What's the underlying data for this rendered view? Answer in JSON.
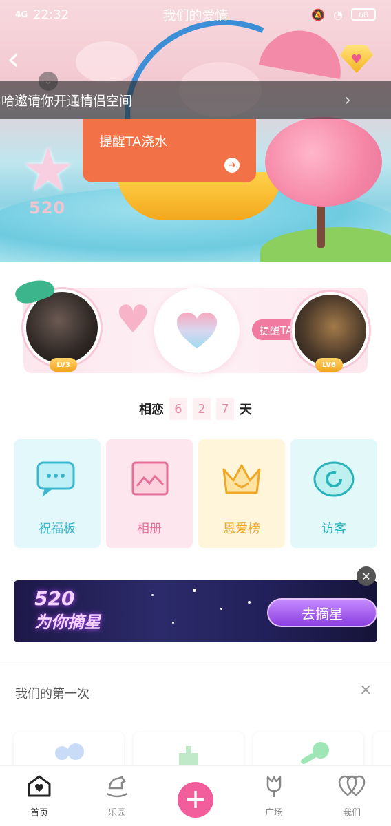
{
  "status_bar": {
    "signal": "4G",
    "time": "22:32",
    "title": "我们的爱情",
    "battery": "68"
  },
  "nav": {
    "back_icon": "chevron-left-icon",
    "gem_icon": "diamond-heart-icon",
    "collapse_icon": "chevron-down-icon"
  },
  "invite_banner": {
    "text": "哈邀请你开通情侣空间",
    "arrow": "›"
  },
  "remind_water": {
    "label": "提醒TA浇水",
    "go": "➔"
  },
  "hero": {
    "star_value": "520"
  },
  "couple": {
    "left_level": "LV3",
    "right_level": "LV6",
    "remind_label": "提醒TA"
  },
  "days": {
    "prefix": "相恋",
    "digits": [
      "6",
      "2",
      "7"
    ],
    "suffix": "天"
  },
  "tiles": [
    {
      "label": "祝福板",
      "icon": "message-bubble-icon",
      "color": "#3bb7cf"
    },
    {
      "label": "相册",
      "icon": "photo-album-icon",
      "color": "#e56f98"
    },
    {
      "label": "恩爱榜",
      "icon": "crown-icon",
      "color": "#f0a726"
    },
    {
      "label": "访客",
      "icon": "visitor-ring-icon",
      "color": "#27b3b9"
    }
  ],
  "promo": {
    "title_line1": "520",
    "title_line2": "为你摘星",
    "button": "去摘星"
  },
  "first_time": {
    "title": "我们的第一次",
    "close": "×"
  },
  "bottom_nav": [
    {
      "label": "首页",
      "icon": "home-heart-icon",
      "active": true
    },
    {
      "label": "乐园",
      "icon": "rocking-horse-icon",
      "active": false
    },
    {
      "label": "+",
      "icon": "add-icon",
      "active": false
    },
    {
      "label": "广场",
      "icon": "tulip-icon",
      "active": false
    },
    {
      "label": "我们",
      "icon": "double-heart-icon",
      "active": false
    }
  ]
}
